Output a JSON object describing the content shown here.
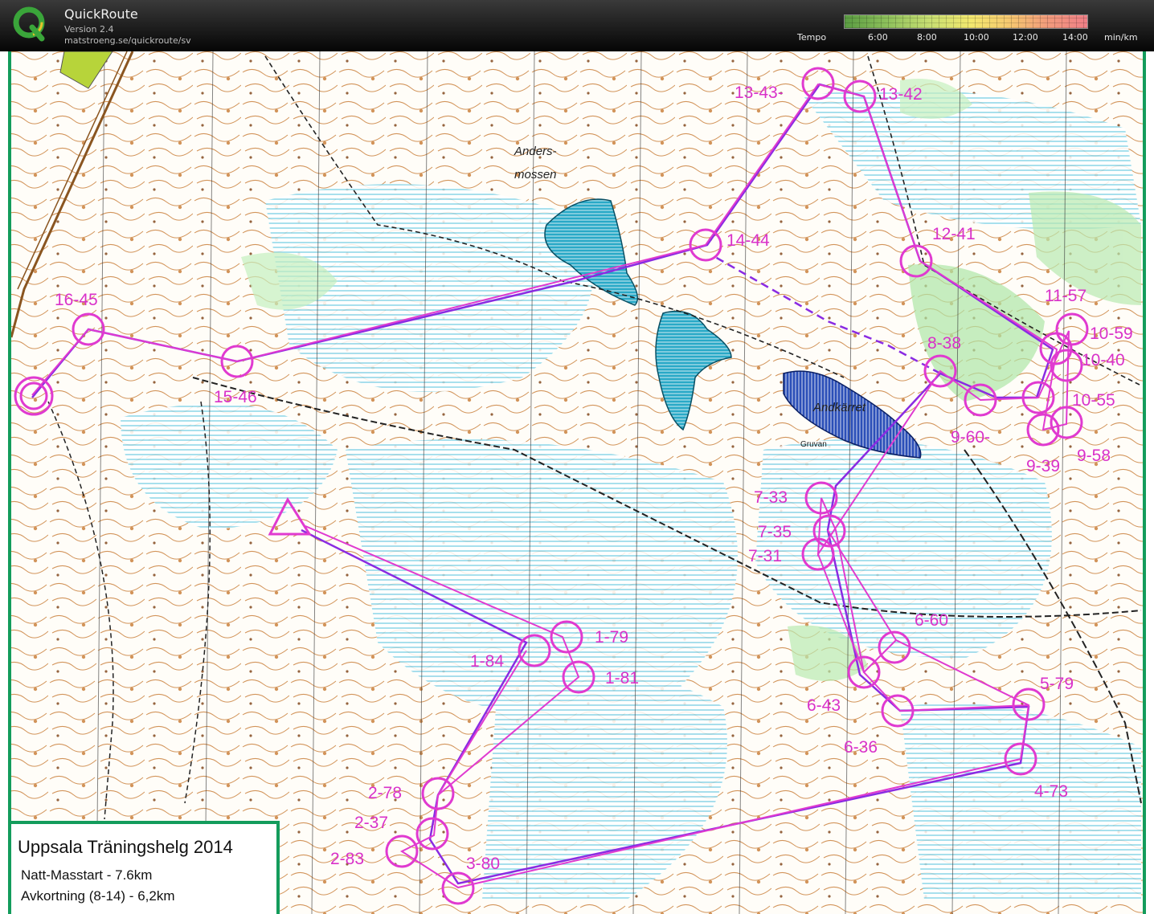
{
  "app": {
    "title": "QuickRoute",
    "version": "Version 2.4",
    "url": "matstroeng.se/quickroute/sv"
  },
  "tempo": {
    "label": "Tempo",
    "ticks": [
      "6:00",
      "8:00",
      "10:00",
      "12:00",
      "14:00"
    ],
    "unit": "min/km",
    "gradient_colors": [
      "#5a9c42",
      "#c8df72",
      "#f3e86e",
      "#f6c870",
      "#ef7f87"
    ]
  },
  "map": {
    "names": [
      "Anders-",
      "mossen",
      "Andkärret",
      "Gruvan"
    ],
    "course_color": "#d931c9",
    "route_color": "#8a2be2",
    "frame_color": "#139c5c",
    "controls": [
      {
        "id": "start",
        "label": ""
      },
      {
        "id": "c1a",
        "label": "1-84"
      },
      {
        "id": "c1b",
        "label": "1-79"
      },
      {
        "id": "c1c",
        "label": "1-81"
      },
      {
        "id": "c2a",
        "label": "2-78"
      },
      {
        "id": "c2b",
        "label": "2-37"
      },
      {
        "id": "c2c",
        "label": "2-83"
      },
      {
        "id": "c3",
        "label": "3-80"
      },
      {
        "id": "c4",
        "label": "4-73"
      },
      {
        "id": "c5",
        "label": "5-79"
      },
      {
        "id": "c6a",
        "label": "6-60"
      },
      {
        "id": "c6b",
        "label": "6-43"
      },
      {
        "id": "c6c",
        "label": "6-36"
      },
      {
        "id": "c7a",
        "label": "7-33"
      },
      {
        "id": "c7b",
        "label": "7-35"
      },
      {
        "id": "c7c",
        "label": "7-31"
      },
      {
        "id": "c8",
        "label": "8-38"
      },
      {
        "id": "c9a",
        "label": "9-60-"
      },
      {
        "id": "c9b",
        "label": "9-39"
      },
      {
        "id": "c9c",
        "label": "9-58"
      },
      {
        "id": "c10a",
        "label": "10-59"
      },
      {
        "id": "c10b",
        "label": "10-40"
      },
      {
        "id": "c10c",
        "label": "10-55"
      },
      {
        "id": "c11",
        "label": "11-57"
      },
      {
        "id": "c12",
        "label": "12-41"
      },
      {
        "id": "c13a",
        "label": "13-43-"
      },
      {
        "id": "c13b",
        "label": "13-42"
      },
      {
        "id": "c14",
        "label": "14-44"
      },
      {
        "id": "c15",
        "label": "15-46"
      },
      {
        "id": "c16",
        "label": "16-45"
      },
      {
        "id": "finish",
        "label": ""
      }
    ]
  },
  "legend": {
    "title": "Uppsala Träningshelg 2014",
    "line1": "Natt-Masstart - 7.6km",
    "line2": "Avkortning (8-14) - 6,2km"
  }
}
